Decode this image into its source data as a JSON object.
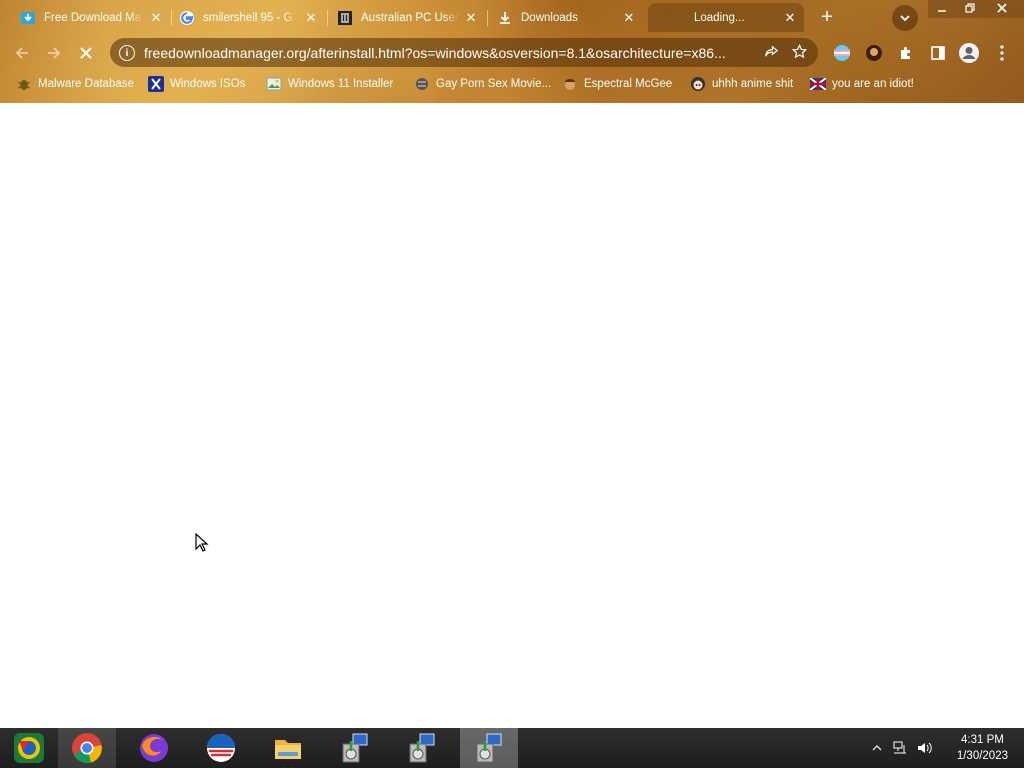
{
  "browser": {
    "tabs": [
      {
        "title": "Free Download Ma",
        "favicon": "fdm-icon",
        "active": false
      },
      {
        "title": "smilershell 95 - G",
        "favicon": "google-icon",
        "active": false
      },
      {
        "title": "Australian PC User",
        "favicon": "archive-icon",
        "active": false
      },
      {
        "title": "Downloads",
        "favicon": "download-icon",
        "active": false
      },
      {
        "title": "Loading...",
        "favicon": "loading-icon",
        "active": true
      }
    ],
    "close_glyph": "✕",
    "new_tab_glyph": "+",
    "url": "freedownloadmanager.org/afterinstall.html?os=windows&osversion=8.1&osarchitecture=x86...",
    "theme_color": "#b77a2a"
  },
  "bookmarks": [
    {
      "label": "Malware Database",
      "icon": "bug-icon"
    },
    {
      "label": "Windows ISOs",
      "icon": "x-logo-icon"
    },
    {
      "label": "Windows 11 Installer",
      "icon": "image-icon"
    },
    {
      "label": "Gay Porn Sex Movie...",
      "icon": "sticker-icon"
    },
    {
      "label": "Espectral McGee",
      "icon": "face-icon"
    },
    {
      "label": "uhhh anime shit",
      "icon": "anime-icon"
    },
    {
      "label": "you are an idiot!",
      "icon": "flag-icon"
    }
  ],
  "taskbar": {
    "apps": [
      "start-icon",
      "chrome-icon",
      "firefox-icon",
      "opera-icon",
      "file-explorer-icon",
      "installer-icon",
      "installer-icon",
      "installer-icon"
    ],
    "clock_time": "4:31 PM",
    "clock_date": "1/30/2023"
  }
}
